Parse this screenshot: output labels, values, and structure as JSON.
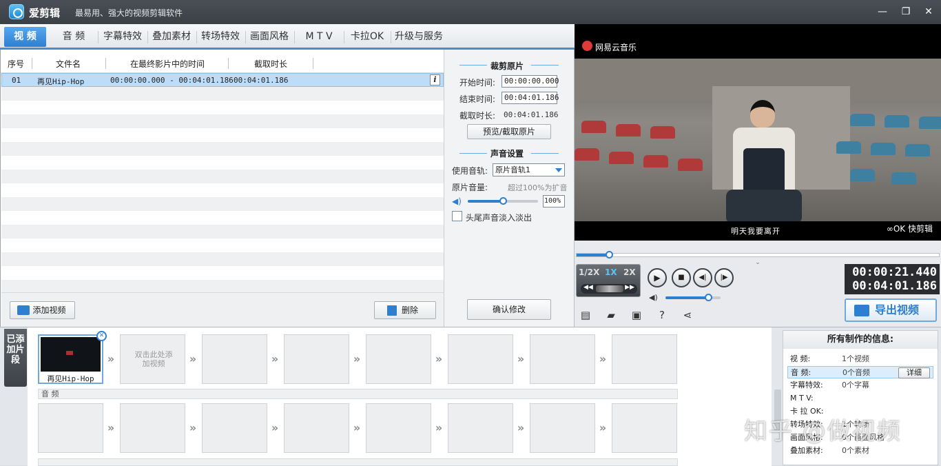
{
  "app": {
    "name": "爱剪辑",
    "slogan": "最易用、强大的视频剪辑软件"
  },
  "tabs": [
    {
      "label": "视 频",
      "active": true
    },
    {
      "label": "音 频"
    },
    {
      "label": "字幕特效"
    },
    {
      "label": "叠加素材"
    },
    {
      "label": "转场特效"
    },
    {
      "label": "画面风格"
    },
    {
      "label": "M T V"
    },
    {
      "label": "卡拉OK"
    },
    {
      "label": "升级与服务"
    }
  ],
  "table": {
    "headers": [
      "序号",
      "文件名",
      "在最终影片中的时间",
      "截取时长"
    ],
    "rows": [
      {
        "index": "01",
        "name": "再见Hip-Hop",
        "time": "00:00:00.000 - 00:04:01.186",
        "duration": "00:04:01.186"
      }
    ],
    "info_icon": "i"
  },
  "left_buttons": {
    "add_video": "添加视频",
    "delete": "删除"
  },
  "crop": {
    "title": "裁剪原片",
    "start_label": "开始时间:",
    "start_value": "00:00:00.000",
    "end_label": "结束时间:",
    "end_value": "00:04:01.186",
    "duration_label": "截取时长:",
    "duration_value": "00:04:01.186",
    "preview_button": "预览/截取原片"
  },
  "sound": {
    "title": "声音设置",
    "track_label": "使用音轨:",
    "track_value": "原片音轨1",
    "volume_label": "原片音量:",
    "volume_hint": "超过100%为扩音",
    "volume_value": "100%",
    "volume_level": 0.5,
    "fade_label": "头尾声音淡入淡出",
    "fade_checked": false
  },
  "confirm_button": "确认修改",
  "player": {
    "source_label": "网易云音乐",
    "subtitle": "明天我要离开",
    "watermark": "快剪辑",
    "speeds": [
      "1/2X",
      "1X",
      "2X"
    ],
    "active_speed": "1X",
    "current_time": "00:00:21.440",
    "total_time": "00:04:01.186",
    "progress": 0.089,
    "volume_level": 0.78,
    "export_button": "导出视频"
  },
  "timeline": {
    "side_tab": "已添加片段",
    "first_clip_label": "再见Hip-Hop",
    "empty_clip_hint": "双击此处添加视频",
    "audio_label": "音 频"
  },
  "info": {
    "title": "所有制作的信息:",
    "rows": [
      {
        "key": "视    频:",
        "value": "1个视频"
      },
      {
        "key": "音    频:",
        "value": "0个音频"
      },
      {
        "key": "字幕特效:",
        "value": "0个字幕"
      },
      {
        "key": "M  T  V:",
        "value": ""
      },
      {
        "key": "卡 拉 OK:",
        "value": ""
      },
      {
        "key": "转场特效:",
        "value": "1个转场"
      },
      {
        "key": "画面风格:",
        "value": "0个画面风格"
      },
      {
        "key": "叠加素材:",
        "value": "0个素材"
      }
    ],
    "detail_button": "详细"
  },
  "site_watermark": "知乎 @做视频"
}
